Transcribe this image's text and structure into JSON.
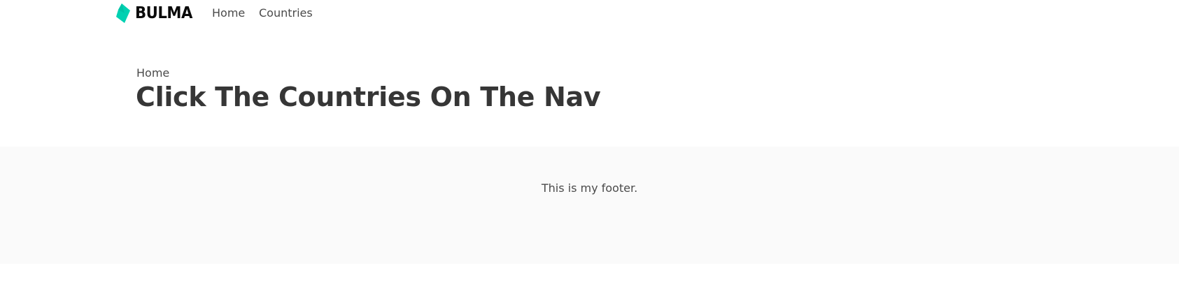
{
  "navbar": {
    "brand": {
      "logo_icon": "bulma-logo-icon",
      "name": "BULMA"
    },
    "items": [
      {
        "label": "Home"
      },
      {
        "label": "Countries"
      }
    ]
  },
  "hero": {
    "subtitle": "Home",
    "title": "Click The Countries On The Nav"
  },
  "footer": {
    "text": "This is my footer."
  },
  "colors": {
    "brand_accent": "#00d1b2",
    "text": "#363636",
    "footer_background": "#fafafa"
  }
}
